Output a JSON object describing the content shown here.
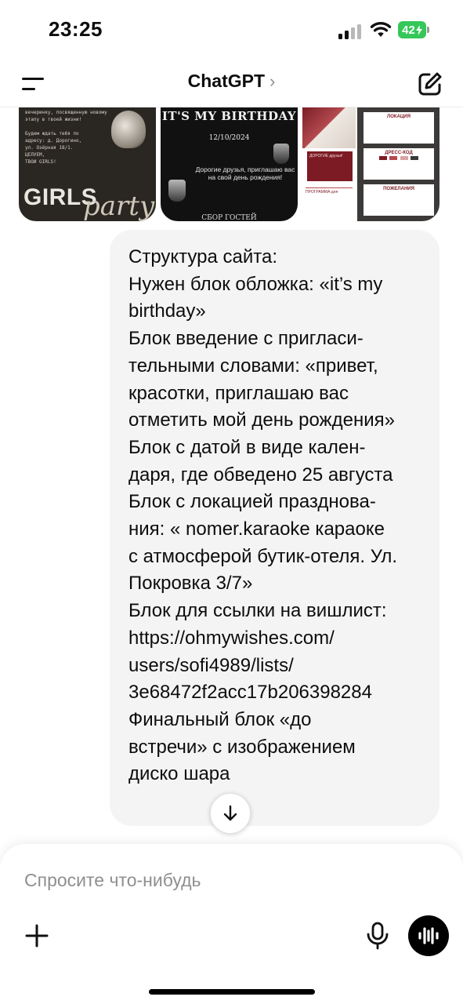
{
  "status_bar": {
    "time": "23:25",
    "battery": "42"
  },
  "header": {
    "title": "ChatGPT",
    "chevron": "›"
  },
  "attachments": {
    "image1": {
      "body_text": "вечеринку, посвященную новому\nэтапу в твоей жизни!\n\nБудем ждать тебя по\nадресу: д. Дорогино,\nул. Озёрная 18/1.",
      "footer_text": "ЦЕЛУЕМ,\n        ТВОИ GIRLS!",
      "big": "GIRLS",
      "script": "party"
    },
    "image2": {
      "title": "IT'S MY BIRTHDAY",
      "date": "12/10/2024",
      "text": "Дорогие друзья, приглашаю вас на свой день рождения!",
      "footer": "СБОР ГОСТЕЙ"
    },
    "image3": {
      "card1": "ЛОКАЦИЯ",
      "card2": "ДРЕСС-КОД",
      "card3": "ПОЖЕЛАНИЯ",
      "red_block": "ДОРОГИЕ друзья!",
      "program": "ПРОГРАММА дня",
      "colors": [
        "#7d1b25",
        "#b44a4f",
        "#d9a3a3",
        "#3c3a39"
      ]
    }
  },
  "message": {
    "lines": [
      "Структура сайта:",
      "Нужен блок обложка: «it’s my",
      "birthday»",
      "Блок введение с пригласи-",
      "тельными словами: «привет,",
      "красотки, приглашаю вас",
      "отметить мой день рождения»",
      "Блок с датой в виде кален-",
      "даря, где обведено 25 августа",
      "Блок с локацией празднова-",
      "ния: « nomer.karaoke караоке",
      "с атмосферой бутик-отеля. Ул.",
      "Покровка 3/7»",
      "Блок для ссылки на вишлист:",
      "https://ohmywishes.com/",
      "users/sofi4989/lists/",
      "3e68472f2acc17b206398284",
      "Финальный блок «до",
      "встречи» с изображением",
      "диско шара"
    ]
  },
  "composer": {
    "placeholder": "Спросите что-нибудь",
    "value": ""
  },
  "icons": {
    "menu": "menu-icon",
    "edit": "new-chat-icon",
    "scroll": "arrow-down-icon",
    "plus": "plus-icon",
    "mic": "microphone-icon",
    "voice": "voice-mode-icon"
  },
  "colors": {
    "bubble": "#f4f4f4",
    "battery": "#35c759",
    "accent": "#000000"
  }
}
